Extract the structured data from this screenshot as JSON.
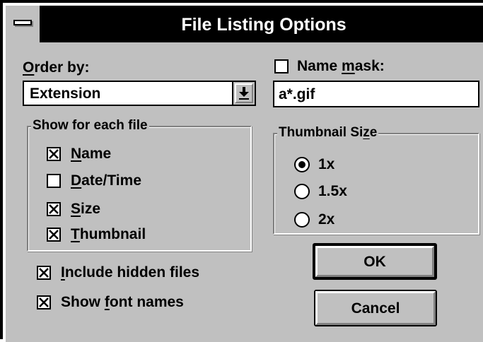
{
  "window": {
    "title": "File Listing Options"
  },
  "order_by": {
    "label_underlined": "O",
    "label_rest": "rder by:",
    "selected": "Extension"
  },
  "name_mask": {
    "checked": false,
    "label_before": "Name ",
    "label_underlined": "m",
    "label_after": "ask:",
    "value": "a*.gif"
  },
  "show_group": {
    "legend": "Show for each file",
    "items": [
      {
        "underlined": "N",
        "rest": "ame",
        "checked": true
      },
      {
        "underlined": "D",
        "rest": "ate/Time",
        "checked": false
      },
      {
        "underlined": "S",
        "rest": "ize",
        "checked": true
      },
      {
        "underlined": "T",
        "rest": "humbnail",
        "checked": true
      }
    ]
  },
  "thumbnail_group": {
    "legend_before": "Thumbnail Si",
    "legend_underlined": "z",
    "legend_after": "e",
    "options": [
      {
        "label": "1x",
        "selected": true
      },
      {
        "label": "1.5x",
        "selected": false
      },
      {
        "label": "2x",
        "selected": false
      }
    ]
  },
  "include_hidden": {
    "checked": true,
    "underlined": "I",
    "rest": "nclude hidden files"
  },
  "show_font_names": {
    "checked": true,
    "before": "Show ",
    "underlined": "f",
    "after": "ont names"
  },
  "buttons": {
    "ok": "OK",
    "cancel": "Cancel"
  },
  "icons": {
    "system_menu": "system-menu-icon",
    "dropdown": "dropdown-arrow-icon",
    "check": "check-x-icon"
  },
  "colors": {
    "title_bar": "#000000",
    "title_text": "#ffffff",
    "face": "#c0c0c0",
    "shadow": "#808080",
    "highlight": "#ffffff"
  }
}
